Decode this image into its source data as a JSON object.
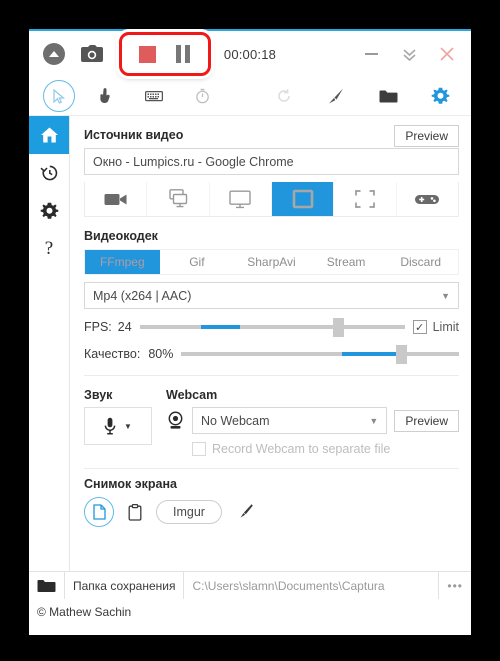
{
  "window": {
    "timer": "00:00:18",
    "accent_color": "#2196dd",
    "record_highlight_color": "#f01818"
  },
  "titlebar": {
    "expand_icon": "chevron-up-circle-icon",
    "screenshot_icon": "camera-icon",
    "stop_icon": "stop-square-icon",
    "pause_icon": "pause-bars-icon",
    "minimize_icon": "minimize-icon",
    "collapse_icon": "double-chevron-down-icon",
    "close_icon": "close-icon"
  },
  "toolbar": {
    "left_icons": [
      "cursor-icon",
      "click-hand-icon",
      "keyboard-icon",
      "timer-icon"
    ],
    "right_icons": [
      "refresh-icon",
      "brush-icon",
      "folder-icon",
      "gear-icon"
    ]
  },
  "sidebar": {
    "items": [
      {
        "label": "home",
        "icon": "home-icon",
        "active": true
      },
      {
        "label": "history",
        "icon": "history-clock-icon",
        "active": false
      },
      {
        "label": "settings",
        "icon": "gear-icon",
        "active": false
      },
      {
        "label": "help",
        "icon": "question-mark-icon",
        "active": false
      }
    ]
  },
  "video_source": {
    "title": "Источник видео",
    "preview_label": "Preview",
    "selected": "Окно  -  Lumpics.ru - Google Chrome",
    "types": [
      {
        "name": "video-camera",
        "icon": "video-camera-icon",
        "active": false
      },
      {
        "name": "multi-screen",
        "icon": "multi-screen-icon",
        "active": false
      },
      {
        "name": "screen",
        "icon": "screen-icon",
        "active": false
      },
      {
        "name": "window",
        "icon": "window-icon",
        "active": true
      },
      {
        "name": "region",
        "icon": "region-crop-icon",
        "active": false
      },
      {
        "name": "game",
        "icon": "gamepad-icon",
        "active": false
      }
    ]
  },
  "video_codec": {
    "title": "Видеокодек",
    "tabs": [
      {
        "label": "FFmpeg",
        "active": true
      },
      {
        "label": "Gif",
        "active": false
      },
      {
        "label": "SharpAvi",
        "active": false
      },
      {
        "label": "Stream",
        "active": false
      },
      {
        "label": "Discard",
        "active": false
      }
    ],
    "format": "Mp4 (x264 | AAC)",
    "fps": {
      "label": "FPS:",
      "value": "24",
      "fill_start_pct": 23,
      "fill_end_pct": 38,
      "thumb_pct": 75,
      "limit_label": "Limit",
      "limit_checked": true,
      "check_glyph": "✓"
    },
    "quality": {
      "label": "Качество:",
      "value": "80%",
      "fill_start_pct": 58,
      "fill_end_pct": 79,
      "thumb_pct": 79
    }
  },
  "audio": {
    "title": "Звук",
    "device_icon": "microphone-icon"
  },
  "webcam": {
    "title": "Webcam",
    "icon": "webcam-icon",
    "selected": "No Webcam",
    "preview_label": "Preview",
    "separate_file_label": "Record Webcam to separate file",
    "separate_file_checked": false
  },
  "screenshot": {
    "title": "Снимок экрана",
    "targets": [
      {
        "name": "file",
        "icon": "file-icon",
        "active": true
      },
      {
        "name": "clipboard",
        "icon": "clipboard-icon",
        "active": false
      }
    ],
    "imgur_label": "Imgur",
    "edit_icon": "pencil-icon"
  },
  "statusbar": {
    "folder_icon": "folder-icon",
    "save_folder_label": "Папка сохранения",
    "save_path": "C:\\Users\\slamn\\Documents\\Captura",
    "more_label": "•••"
  },
  "footer": {
    "copyright": "© Mathew Sachin"
  }
}
